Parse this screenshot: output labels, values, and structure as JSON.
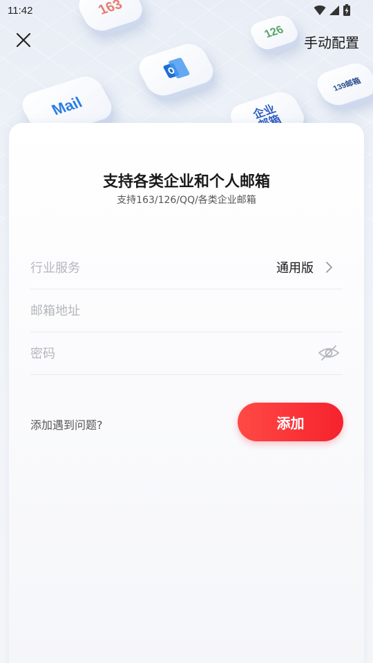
{
  "status_bar": {
    "time": "11:42",
    "icons": [
      "wifi-icon",
      "cellular-signal-icon",
      "battery-charging-icon"
    ]
  },
  "header": {
    "close_icon": "close-icon",
    "manual_config_label": "手动配置"
  },
  "banner_tiles": [
    {
      "label": "163",
      "color": "#e77b73"
    },
    {
      "label": "126",
      "color": "#5aa36b"
    },
    {
      "label": "",
      "icon": "outlook-icon",
      "color": "#1f6fd1"
    },
    {
      "label": "139邮箱",
      "color": "#2b4f8f"
    },
    {
      "label": "Mail",
      "color": "#2a7de1"
    },
    {
      "label": "企业\n邮箱",
      "color": "#2f5fc4"
    }
  ],
  "card": {
    "title": "支持各类企业和个人邮箱",
    "subtitle": "支持163/126/QQ/各类企业邮箱",
    "industry_row": {
      "label": "行业服务",
      "value": "通用版",
      "icon": "chevron-right-icon"
    },
    "email_field": {
      "placeholder": "邮箱地址",
      "value": ""
    },
    "password_field": {
      "placeholder": "密码",
      "value": "",
      "icon": "eye-off-icon"
    },
    "problem_link": "添加遇到问题?",
    "add_button": "添加"
  },
  "colors": {
    "accent": "#f5222d",
    "placeholder": "#b5b7bc",
    "text": "#1a1a1a"
  }
}
